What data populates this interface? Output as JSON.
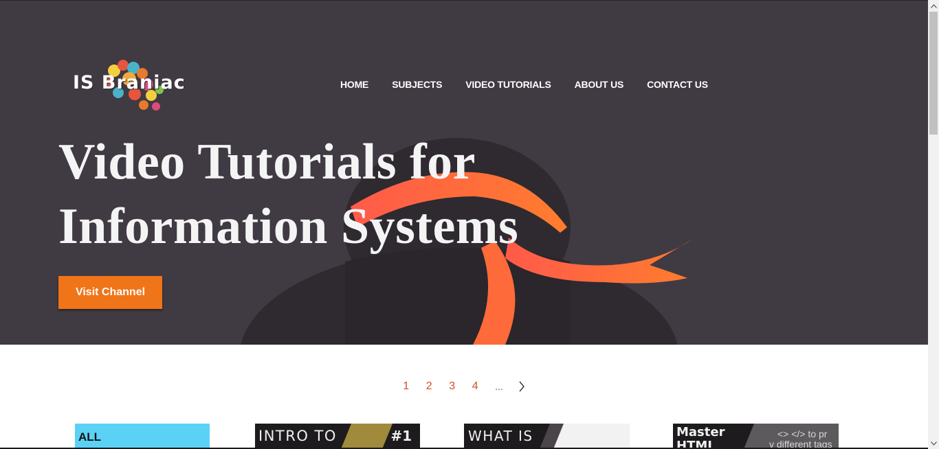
{
  "brand": {
    "logo_text": "IS Braniac"
  },
  "nav": {
    "items": [
      "HOME",
      "SUBJECTS",
      "VIDEO TUTORIALS",
      "ABOUT US",
      "CONTACT US"
    ]
  },
  "hero": {
    "headline_line1": "Video Tutorials for",
    "headline_line2": "Information Systems",
    "cta_label": "Visit Channel"
  },
  "pagination": {
    "pages": [
      "1",
      "2",
      "3",
      "4"
    ],
    "ellipsis": "...",
    "next_icon": "chevron-right-icon"
  },
  "cards": [
    {
      "title": "ALL"
    },
    {
      "title": "INTRO TO",
      "badge": "#1"
    },
    {
      "title": "WHAT IS"
    },
    {
      "title": "Master",
      "title_line2": "HTML",
      "caption_line1": "<> </> to pr",
      "caption_line2": "v different tags"
    }
  ],
  "colors": {
    "hero_bg": "#403a43",
    "accent": "#f07418",
    "link": "#d34b24",
    "headband": "#ff6b3d"
  }
}
